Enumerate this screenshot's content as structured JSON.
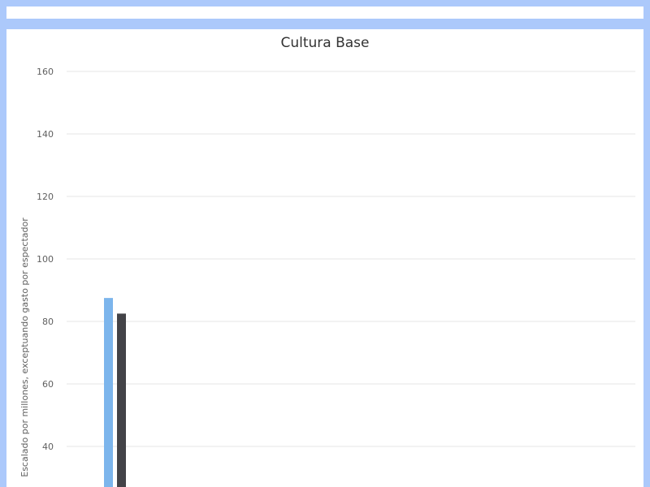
{
  "chart_data": {
    "type": "bar",
    "title": "Cultura Base",
    "xlabel": "",
    "ylabel": "Escalado por millones, exceptuando gasto por espectador",
    "y_ticks": [
      40,
      60,
      80,
      100,
      120,
      140,
      160
    ],
    "grid": true,
    "categories": [
      ""
    ],
    "series": [
      {
        "color": "#7cb5ec",
        "values": [
          87.5
        ]
      },
      {
        "color": "#434348",
        "values": [
          82.5
        ]
      }
    ]
  }
}
